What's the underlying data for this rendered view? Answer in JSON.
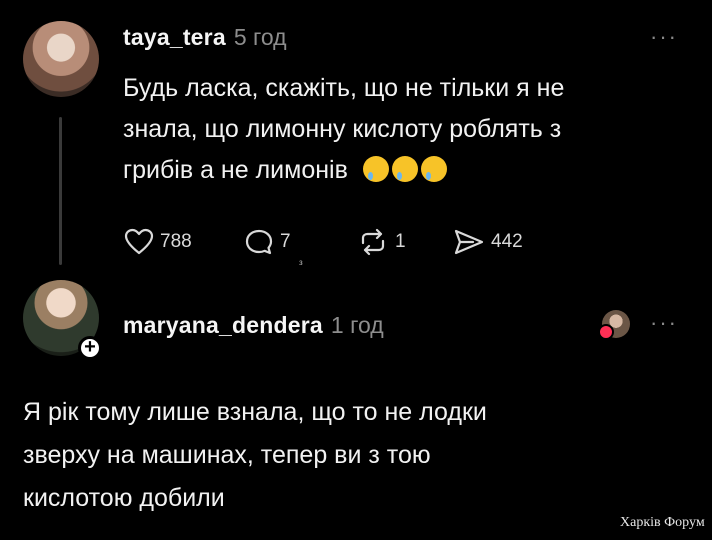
{
  "post": {
    "username": "taya_tera",
    "time": "5 год",
    "text_line1": "Будь ласка, скажіть, що не тільки я не",
    "text_line2": "знала, що лимонну кислоту роблять з",
    "text_line3": "грибів а не лимонів",
    "emoji": [
      "crying-face-emoji",
      "crying-face-emoji",
      "crying-face-emoji"
    ],
    "likes": "788",
    "comments": "7",
    "reposts": "1",
    "shares": "442",
    "small_mark": "з",
    "menu": "···"
  },
  "reply": {
    "username": "maryana_dendera",
    "time": "1 год",
    "text_line1": "Я рік тому лише взнала, що то не лодки",
    "text_line2": "зверху на машинах, тепер ви з тою",
    "text_line3": "кислотою добили",
    "plus": "+",
    "menu": "···"
  },
  "watermark": "Харків Форум",
  "colors": {
    "background": "#000000",
    "text": "#f2f2f2",
    "muted": "#8d8d8d",
    "heart": "#ff2f55"
  }
}
